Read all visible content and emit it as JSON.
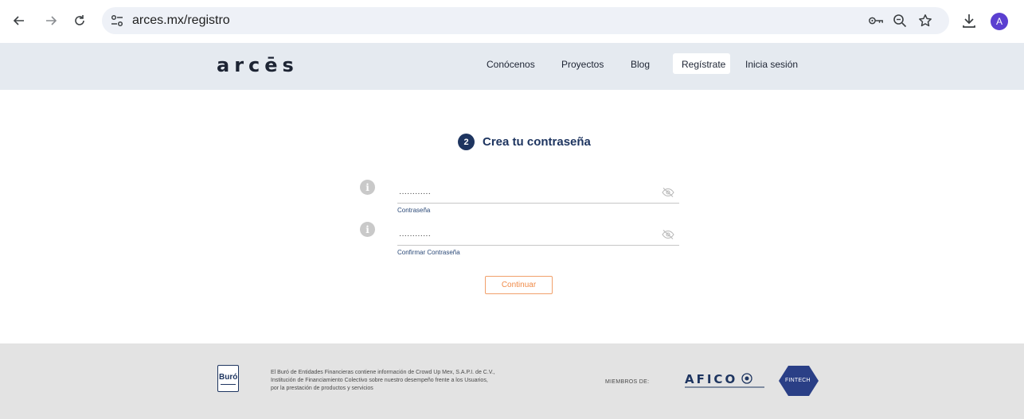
{
  "browser": {
    "url": "arces.mx/registro",
    "avatar_letter": "A"
  },
  "site": {
    "logo": "arcēs",
    "nav": [
      "Conócenos",
      "Proyectos",
      "Blog",
      "Regístrate",
      "Inicia sesión"
    ]
  },
  "form": {
    "step_number": "2",
    "step_title": "Crea tu contraseña",
    "password_value": "············",
    "password_label": "Contraseña",
    "confirm_value": "············",
    "confirm_label": "Confirmar Contraseña",
    "info_glyph": "i",
    "continue_label": "Continuar"
  },
  "footer": {
    "buro_label": "Buró",
    "disclaimer_line1": "El Buró de Entidades Financieras contiene información de Crowd Up Mex, S.A.P.I. de C.V.,",
    "disclaimer_line2": "Institución de Financiamiento Colectivo sobre nuestro desempeño frente a los Usuarios,",
    "disclaimer_line3": "por la prestación de productos y servicios",
    "members_label": "MIEMBROS DE:",
    "afico_label": "AFICO",
    "fintech_label": "FINTECH"
  },
  "colors": {
    "accent": "#1e3560",
    "button": "#f08a47",
    "header_bg": "#e5eaf0",
    "footer_bg": "#e3e3e3"
  },
  "icons": [
    "back-arrow-icon",
    "forward-arrow-icon",
    "reload-icon",
    "site-settings-icon",
    "password-key-icon",
    "zoom-icon",
    "bookmark-star-icon",
    "download-icon",
    "info-icon",
    "eye-off-icon",
    "fintech-shield-icon"
  ]
}
